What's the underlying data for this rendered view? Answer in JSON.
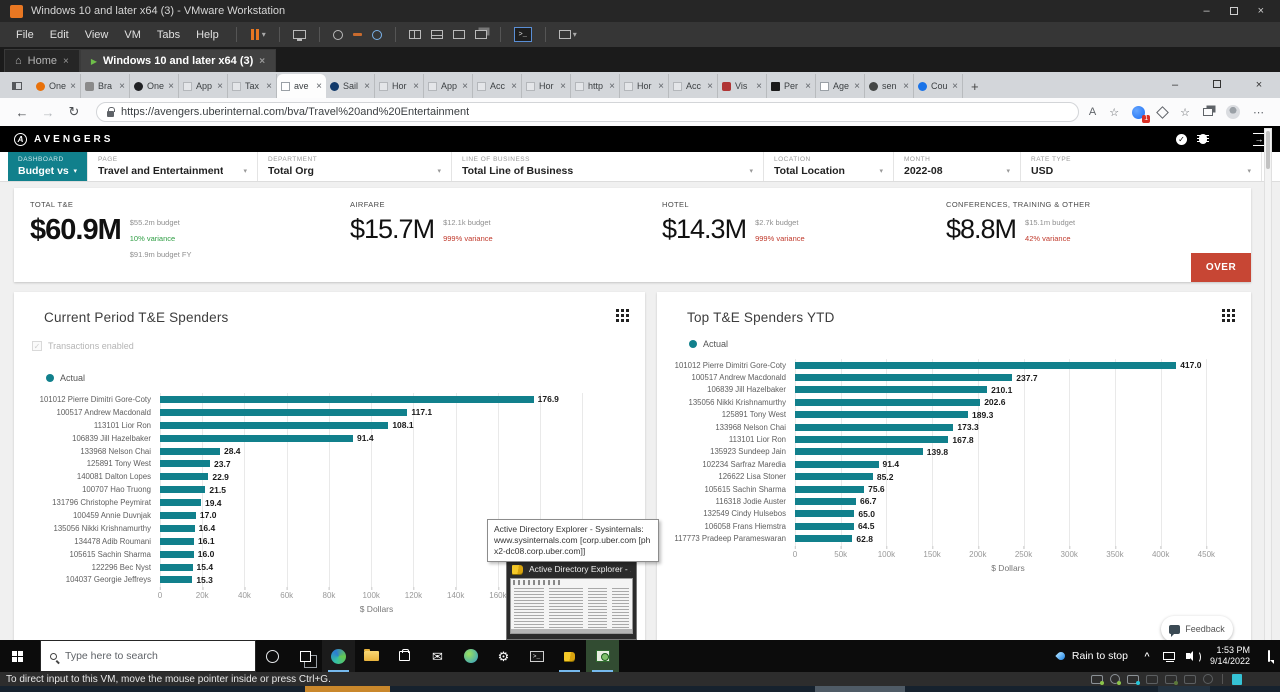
{
  "vmware": {
    "window_title": "Windows 10 and later x64 (3) - VMware Workstation",
    "menus": [
      "File",
      "Edit",
      "View",
      "VM",
      "Tabs",
      "Help"
    ],
    "tabs": [
      {
        "label": "Home",
        "active": false
      },
      {
        "label": "Windows 10 and later x64 (3)",
        "active": true
      }
    ],
    "status_hint": "To direct input to this VM, move the mouse pointer inside or press Ctrl+G."
  },
  "browser": {
    "tabs": [
      {
        "label": "One",
        "icon": "circle",
        "color": "#e8710a"
      },
      {
        "label": "Bra",
        "icon": "glyph",
        "color": "#8a8a8a"
      },
      {
        "label": "One",
        "icon": "circle",
        "color": "#202124"
      },
      {
        "label": "App",
        "icon": "placeholder",
        "color": "#c4c7cb"
      },
      {
        "label": "Tax",
        "icon": "placeholder",
        "color": "#c4c7cb"
      },
      {
        "label": "ave",
        "icon": "page",
        "color": "#9aa0a6",
        "active": true
      },
      {
        "label": "Sail",
        "icon": "circle",
        "color": "#123a6b"
      },
      {
        "label": "Hor",
        "icon": "placeholder",
        "color": "#c4c7cb"
      },
      {
        "label": "App",
        "icon": "placeholder",
        "color": "#c4c7cb"
      },
      {
        "label": "Acc",
        "icon": "placeholder",
        "color": "#c4c7cb"
      },
      {
        "label": "Hor",
        "icon": "placeholder",
        "color": "#c4c7cb"
      },
      {
        "label": "http",
        "icon": "placeholder",
        "color": "#c4c7cb"
      },
      {
        "label": "Hor",
        "icon": "placeholder",
        "color": "#c4c7cb"
      },
      {
        "label": "Acc",
        "icon": "placeholder",
        "color": "#c4c7cb"
      },
      {
        "label": "Vis",
        "icon": "glyph",
        "color": "#b03535"
      },
      {
        "label": "Per",
        "icon": "square",
        "color": "#1a1a1a"
      },
      {
        "label": "Age",
        "icon": "page",
        "color": "#9aa0a6"
      },
      {
        "label": "sen",
        "icon": "circle",
        "color": "#444746"
      },
      {
        "label": "Cou",
        "icon": "circle",
        "color": "#1a73e8"
      }
    ],
    "url": "https://avengers.uberinternal.com/bva/Travel%20and%20Entertainment",
    "extension_badge": "1"
  },
  "dashboard": {
    "brand": "AVENGERS",
    "filters": [
      {
        "label": "DASHBOARD",
        "value": "Budget vs Actual ...",
        "accent": true
      },
      {
        "label": "PAGE",
        "value": "Travel and Entertainment"
      },
      {
        "label": "DEPARTMENT",
        "value": "Total Org"
      },
      {
        "label": "LINE OF BUSINESS",
        "value": "Total Line of Business"
      },
      {
        "label": "LOCATION",
        "value": "Total Location"
      },
      {
        "label": "MONTH",
        "value": "2022-08"
      },
      {
        "label": "RATE TYPE",
        "value": "USD"
      }
    ],
    "kpis": [
      {
        "label": "TOTAL T&E",
        "value": "$60.9M",
        "emphasis": true,
        "details": [
          {
            "text": "$55.2m budget",
            "tone": "muted"
          },
          {
            "text": "10% variance",
            "tone": "good"
          },
          {
            "text": "$91.9m budget FY",
            "tone": "muted"
          }
        ]
      },
      {
        "label": "AIRFARE",
        "value": "$15.7M",
        "emphasis": false,
        "details": [
          {
            "text": "$12.1k budget",
            "tone": "muted"
          },
          {
            "text": "999% variance",
            "tone": "bad"
          }
        ]
      },
      {
        "label": "HOTEL",
        "value": "$14.3M",
        "emphasis": false,
        "details": [
          {
            "text": "$2.7k budget",
            "tone": "muted"
          },
          {
            "text": "999% variance",
            "tone": "bad"
          }
        ]
      },
      {
        "label": "CONFERENCES, TRAINING & OTHER",
        "value": "$8.8M",
        "emphasis": false,
        "details": [
          {
            "text": "$15.1m budget",
            "tone": "muted"
          },
          {
            "text": "42% variance",
            "tone": "bad"
          }
        ]
      }
    ],
    "status_badge": "OVER",
    "feedback_label": "Feedback",
    "colors": {
      "accent_teal": "#11808c",
      "bad_red": "#c0392b",
      "good_green": "#2f9e44",
      "badge_red": "#c74634"
    }
  },
  "chart_data": [
    {
      "type": "bar",
      "orientation": "horizontal",
      "title": "Current Period T&E Spenders",
      "checkbox_label": "Transactions enabled",
      "legend": [
        {
          "name": "Actual",
          "color": "#11808c"
        }
      ],
      "xlabel": "$ Dollars",
      "unit_note": "bar value labels are in thousands of dollars",
      "x_tick_labels": [
        "0",
        "20k",
        "40k",
        "60k",
        "80k",
        "100k",
        "120k",
        "140k",
        "160k"
      ],
      "x_tick_values": [
        0,
        20,
        40,
        60,
        80,
        100,
        120,
        140,
        160
      ],
      "x_grid_values": [
        0,
        20,
        40,
        60,
        80,
        100,
        120,
        140,
        160,
        180,
        200
      ],
      "x_max": 205,
      "color": "#11808c",
      "categories": [
        "101012 Pierre Dimitri Gore-Coty",
        "100517 Andrew Macdonald",
        "113101 Lior Ron",
        "106839 Jill Hazelbaker",
        "133968 Nelson Chai",
        "125891 Tony West",
        "140081 Dalton Lopes",
        "100707 Hao Truong",
        "131796 Christophe Peymirat",
        "100459 Annie Duvnjak",
        "135056 Nikki Krishnamurthy",
        "134478 Adib Roumani",
        "105615 Sachin Sharma",
        "122296 Bec Nyst",
        "104037 Georgie Jeffreys"
      ],
      "values": [
        176.9,
        117.1,
        108.1,
        91.4,
        28.4,
        23.7,
        22.9,
        21.5,
        19.4,
        17.0,
        16.4,
        16.1,
        16.0,
        15.4,
        15.3
      ]
    },
    {
      "type": "bar",
      "orientation": "horizontal",
      "title": "Top T&E Spenders YTD",
      "checkbox_label": null,
      "legend": [
        {
          "name": "Actual",
          "color": "#11808c"
        }
      ],
      "xlabel": "$ Dollars",
      "unit_note": "bar value labels are in thousands of dollars",
      "x_tick_labels": [
        "0",
        "50k",
        "100k",
        "150k",
        "200k",
        "250k",
        "300k",
        "350k",
        "400k",
        "450k"
      ],
      "x_tick_values": [
        0,
        50,
        100,
        150,
        200,
        250,
        300,
        350,
        400,
        450
      ],
      "x_grid_values": [
        0,
        50,
        100,
        150,
        200,
        250,
        300,
        350,
        400,
        450
      ],
      "x_max": 466,
      "color": "#11808c",
      "categories": [
        "101012 Pierre Dimitri Gore-Coty",
        "100517 Andrew Macdonald",
        "106839 Jill Hazelbaker",
        "135056 Nikki Krishnamurthy",
        "125891 Tony West",
        "133968 Nelson Chai",
        "113101 Lior Ron",
        "135923 Sundeep Jain",
        "102234 Sarfraz Maredia",
        "126622 Lisa Stoner",
        "105615 Sachin Sharma",
        "116318 Jodie Auster",
        "132549 Cindy Hulsebos",
        "106058 Frans Hiemstra",
        "117773 Pradeep Parameswaran"
      ],
      "values": [
        417.0,
        237.7,
        210.1,
        202.6,
        189.3,
        173.3,
        167.8,
        139.8,
        91.4,
        85.2,
        75.6,
        66.7,
        65.0,
        64.5,
        62.8
      ]
    }
  ],
  "tooltip_text": "Active Directory Explorer - Sysinternals: www.sysinternals.com [corp.uber.com [phx2-dc08.corp.uber.com]]",
  "taskbar_preview": {
    "title": "Active Directory Explorer - ..."
  },
  "taskbar": {
    "search_placeholder": "Type here to search",
    "weather": "Rain to stop",
    "time": "1:53 PM",
    "date": "9/14/2022"
  },
  "icons": {
    "close": "×",
    "new_tab": "+",
    "minimize": "–",
    "back": "←",
    "forward": "→",
    "refresh": "↻",
    "caret": "▾",
    "overflow": "⋯",
    "home": "⌂",
    "play": "▶",
    "check": "✓",
    "chevron_up": "^",
    "gear": "⚙",
    "mail": "✉",
    "cmd": ">_",
    "read_aloud": "A",
    "star": "☆",
    "logo_letter": "A",
    "brand_letter": "A"
  }
}
